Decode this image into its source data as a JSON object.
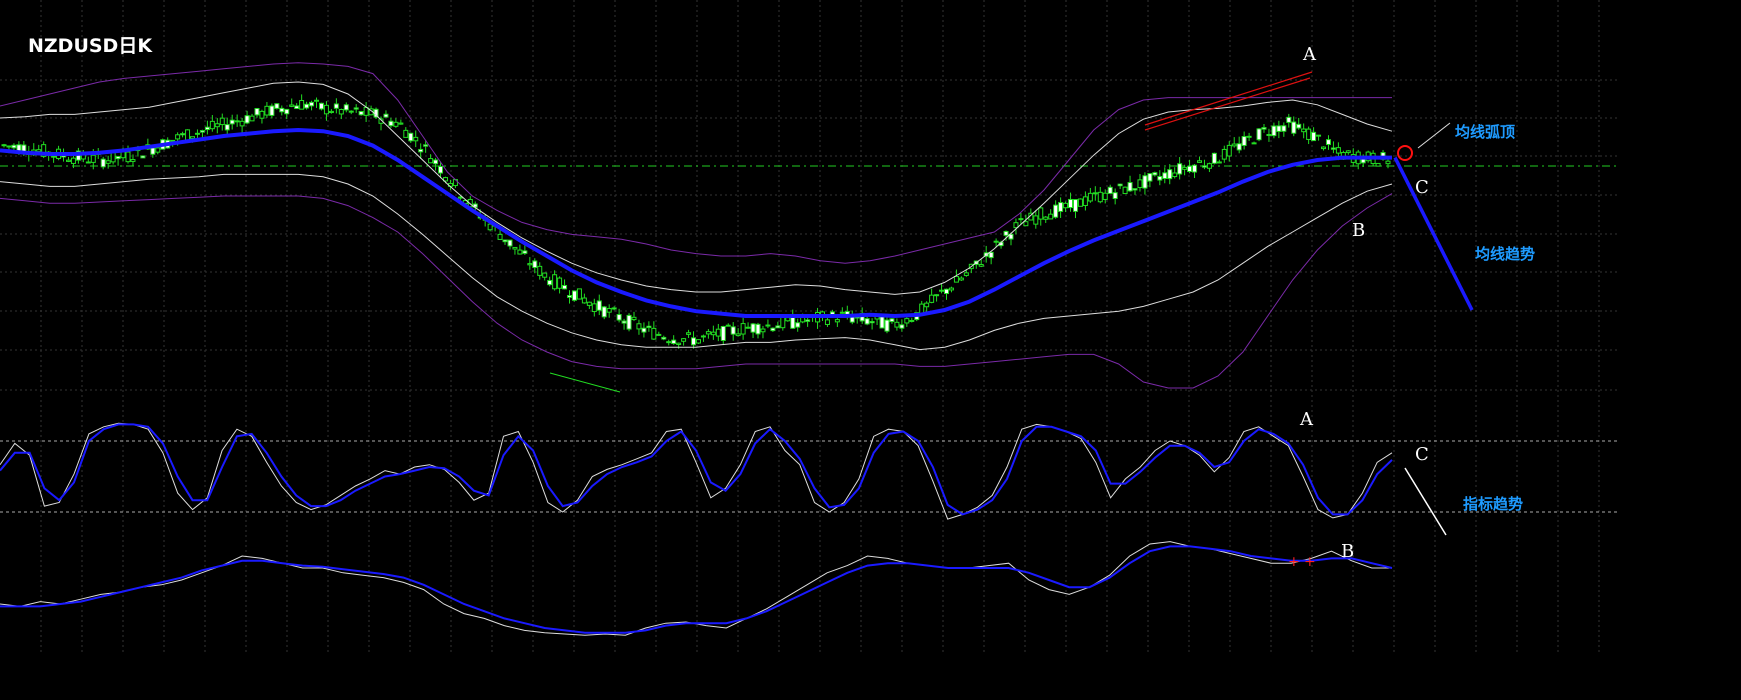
{
  "chart_data": [
    {
      "type": "line",
      "title": "NZDUSD日K",
      "panel": "price",
      "series": [
        {
          "values": [
            0.62,
            0.6,
            0.55,
            0.52,
            0.5,
            0.53,
            0.6,
            0.68,
            0.74,
            0.8,
            0.86,
            0.92,
            0.97,
            0.93,
            0.9,
            0.88,
            0.8,
            0.6,
            0.35,
            0.1,
            -0.1,
            -0.3,
            -0.48,
            -0.6,
            -0.72,
            -0.82,
            -0.92,
            -0.98,
            -1.0,
            -0.95,
            -0.9,
            -0.88,
            -0.85,
            -0.82,
            -0.8,
            -0.84,
            -0.88,
            -0.78,
            -0.6,
            -0.45,
            -0.25,
            -0.05,
            0.05,
            0.1,
            0.18,
            0.24,
            0.3,
            0.38,
            0.45,
            0.5,
            0.62,
            0.74,
            0.8,
            0.7,
            0.55,
            0.52,
            0.5
          ]
        },
        {
          "values": [
            0.58,
            0.56,
            0.55,
            0.55,
            0.56,
            0.58,
            0.61,
            0.64,
            0.67,
            0.7,
            0.72,
            0.74,
            0.75,
            0.74,
            0.7,
            0.62,
            0.5,
            0.36,
            0.22,
            0.08,
            -0.05,
            -0.18,
            -0.3,
            -0.42,
            -0.52,
            -0.6,
            -0.67,
            -0.72,
            -0.76,
            -0.78,
            -0.8,
            -0.8,
            -0.8,
            -0.8,
            -0.8,
            -0.79,
            -0.8,
            -0.79,
            -0.75,
            -0.68,
            -0.58,
            -0.47,
            -0.36,
            -0.26,
            -0.17,
            -0.09,
            -0.01,
            0.07,
            0.15,
            0.23,
            0.32,
            0.4,
            0.46,
            0.5,
            0.52,
            0.52,
            0.52
          ]
        },
        {
          "values": [
            0.85,
            0.86,
            0.88,
            0.88,
            0.9,
            0.92,
            0.94,
            0.98,
            1.02,
            1.06,
            1.1,
            1.14,
            1.15,
            1.13,
            1.05,
            0.9,
            0.7,
            0.5,
            0.3,
            0.12,
            -0.02,
            -0.15,
            -0.26,
            -0.36,
            -0.44,
            -0.5,
            -0.55,
            -0.58,
            -0.6,
            -0.6,
            -0.58,
            -0.56,
            -0.54,
            -0.55,
            -0.58,
            -0.6,
            -0.62,
            -0.6,
            -0.52,
            -0.4,
            -0.24,
            -0.05,
            0.14,
            0.34,
            0.54,
            0.72,
            0.84,
            0.9,
            0.92,
            0.93,
            0.95,
            0.98,
            1.0,
            0.96,
            0.88,
            0.8,
            0.74
          ]
        },
        {
          "values": [
            0.32,
            0.3,
            0.28,
            0.28,
            0.3,
            0.32,
            0.34,
            0.35,
            0.36,
            0.38,
            0.38,
            0.38,
            0.38,
            0.36,
            0.3,
            0.2,
            0.05,
            -0.12,
            -0.3,
            -0.48,
            -0.64,
            -0.76,
            -0.86,
            -0.94,
            -1.0,
            -1.04,
            -1.06,
            -1.06,
            -1.06,
            -1.04,
            -1.02,
            -1.02,
            -1.0,
            -0.99,
            -0.98,
            -1.0,
            -1.04,
            -1.08,
            -1.06,
            -1.0,
            -0.92,
            -0.86,
            -0.82,
            -0.8,
            -0.78,
            -0.76,
            -0.72,
            -0.66,
            -0.6,
            -0.5,
            -0.36,
            -0.22,
            -0.1,
            0.02,
            0.14,
            0.24,
            0.3
          ]
        },
        {
          "values": [
            0.95,
            1.0,
            1.05,
            1.1,
            1.15,
            1.18,
            1.2,
            1.22,
            1.24,
            1.26,
            1.28,
            1.3,
            1.31,
            1.3,
            1.28,
            1.22,
            1.0,
            0.7,
            0.4,
            0.2,
            0.08,
            -0.02,
            -0.08,
            -0.12,
            -0.14,
            -0.16,
            -0.2,
            -0.25,
            -0.28,
            -0.3,
            -0.3,
            -0.28,
            -0.3,
            -0.34,
            -0.36,
            -0.34,
            -0.3,
            -0.25,
            -0.2,
            -0.15,
            -0.1,
            0.05,
            0.25,
            0.5,
            0.75,
            0.92,
            1.0,
            1.02,
            1.02,
            1.02,
            1.02,
            1.02,
            1.02,
            1.02,
            1.02,
            1.02,
            1.02
          ]
        },
        {
          "values": [
            0.18,
            0.16,
            0.14,
            0.14,
            0.15,
            0.16,
            0.17,
            0.18,
            0.19,
            0.2,
            0.2,
            0.2,
            0.2,
            0.18,
            0.12,
            0.02,
            -0.1,
            -0.28,
            -0.48,
            -0.68,
            -0.86,
            -1.0,
            -1.1,
            -1.18,
            -1.22,
            -1.24,
            -1.24,
            -1.24,
            -1.24,
            -1.22,
            -1.2,
            -1.2,
            -1.2,
            -1.2,
            -1.2,
            -1.2,
            -1.2,
            -1.22,
            -1.22,
            -1.2,
            -1.18,
            -1.16,
            -1.14,
            -1.12,
            -1.12,
            -1.2,
            -1.35,
            -1.4,
            -1.4,
            -1.3,
            -1.1,
            -0.8,
            -0.5,
            -0.25,
            -0.05,
            0.1,
            0.22
          ]
        }
      ],
      "projection": {
        "values": [
          0.52,
          -0.75
        ]
      },
      "annotations": [
        "A",
        "B",
        "C",
        "均线弧顶",
        "均线趋势"
      ]
    },
    {
      "type": "line",
      "panel": "oscillator-1",
      "ylim": [
        0,
        100
      ],
      "levels": [
        80,
        20
      ],
      "series": [
        {
          "values": [
            60,
            78,
            68,
            25,
            28,
            52,
            86,
            92,
            95,
            94,
            90,
            70,
            36,
            22,
            32,
            72,
            90,
            84,
            62,
            42,
            28,
            22,
            26,
            34,
            42,
            48,
            55,
            52,
            58,
            60,
            56,
            45,
            30,
            36,
            84,
            88,
            62,
            28,
            20,
            30,
            50,
            56,
            60,
            65,
            70,
            88,
            90,
            62,
            32,
            40,
            60,
            88,
            92,
            72,
            60,
            28,
            20,
            28,
            48,
            84,
            90,
            88,
            76,
            46,
            14,
            18,
            24,
            34,
            58,
            90,
            94,
            92,
            88,
            82,
            62,
            32,
            48,
            58,
            72,
            80,
            76,
            68,
            54,
            66,
            88,
            92,
            84,
            76,
            50,
            22,
            15,
            18,
            36,
            62,
            70
          ]
        },
        {
          "values": [
            55,
            70,
            70,
            40,
            30,
            45,
            80,
            90,
            94,
            94,
            92,
            78,
            50,
            30,
            30,
            58,
            84,
            86,
            70,
            50,
            34,
            25,
            25,
            30,
            38,
            44,
            50,
            52,
            55,
            58,
            57,
            50,
            38,
            34,
            68,
            84,
            72,
            42,
            25,
            28,
            42,
            52,
            58,
            62,
            67,
            80,
            88,
            72,
            45,
            38,
            52,
            78,
            90,
            80,
            65,
            40,
            24,
            26,
            40,
            70,
            86,
            88,
            80,
            58,
            26,
            18,
            22,
            30,
            48,
            80,
            92,
            92,
            88,
            84,
            72,
            44,
            44,
            54,
            66,
            76,
            76,
            70,
            58,
            62,
            80,
            90,
            86,
            78,
            60,
            32,
            18,
            18,
            30,
            52,
            64
          ]
        }
      ],
      "projection": {
        "values": [
          80,
          20
        ]
      },
      "annotations": [
        "A",
        "B",
        "C",
        "指标趋势"
      ]
    },
    {
      "type": "line",
      "panel": "oscillator-2",
      "series": [
        {
          "values": [
            40,
            38,
            42,
            40,
            44,
            48,
            50,
            54,
            56,
            60,
            66,
            72,
            80,
            78,
            74,
            70,
            70,
            66,
            64,
            62,
            58,
            52,
            40,
            32,
            28,
            22,
            18,
            16,
            15,
            14,
            15,
            14,
            20,
            24,
            25,
            22,
            20,
            28,
            36,
            46,
            56,
            66,
            72,
            80,
            78,
            74,
            72,
            70,
            70,
            72,
            74,
            60,
            52,
            48,
            54,
            64,
            80,
            90,
            92,
            88,
            86,
            82,
            78,
            74,
            74,
            78,
            84,
            76,
            70,
            70
          ]
        },
        {
          "values": [
            38,
            38,
            38,
            40,
            42,
            46,
            50,
            54,
            58,
            62,
            68,
            72,
            76,
            76,
            74,
            72,
            71,
            69,
            67,
            65,
            62,
            56,
            48,
            40,
            34,
            28,
            24,
            20,
            18,
            16,
            16,
            16,
            18,
            22,
            24,
            24,
            24,
            28,
            34,
            42,
            50,
            58,
            66,
            72,
            74,
            74,
            72,
            70,
            70,
            70,
            70,
            66,
            60,
            54,
            54,
            62,
            74,
            84,
            88,
            88,
            86,
            84,
            80,
            78,
            76,
            76,
            78,
            78,
            74,
            70
          ]
        }
      ],
      "markers": [
        "+",
        "+"
      ],
      "annotations": [
        "B"
      ]
    }
  ]
}
